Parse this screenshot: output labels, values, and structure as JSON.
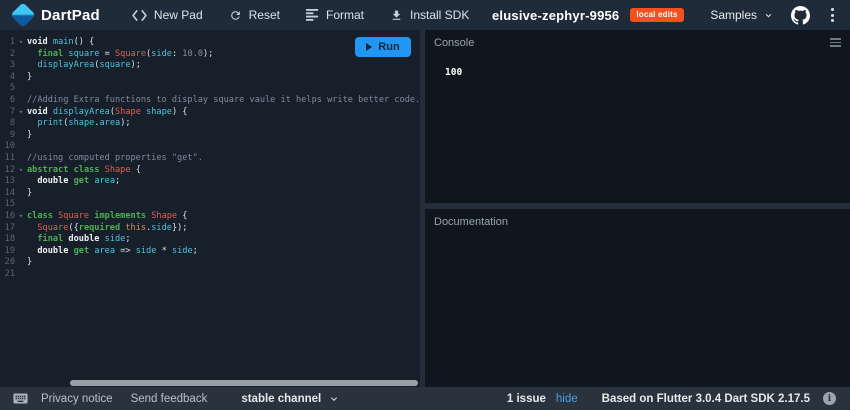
{
  "colors": {
    "accent_blue": "#2196f3",
    "badge_orange": "#f4511e",
    "link_blue": "#4b9fea"
  },
  "header": {
    "logo_text": "DartPad",
    "nav": [
      {
        "label": "New Pad"
      },
      {
        "label": "Reset"
      },
      {
        "label": "Format"
      },
      {
        "label": "Install SDK"
      }
    ],
    "title": "elusive-zephyr-9956",
    "badge": "local edits",
    "samples_label": "Samples"
  },
  "editor": {
    "run_label": "Run",
    "fold_glyph": "▾",
    "lines": [
      {
        "n": "1",
        "fold": true,
        "tokens": [
          [
            "bd",
            "void"
          ],
          [
            "pl",
            " "
          ],
          [
            "id",
            "main"
          ],
          [
            "pl",
            "() {"
          ]
        ]
      },
      {
        "n": "2",
        "fold": false,
        "tokens": [
          [
            "pl",
            "  "
          ],
          [
            "kw",
            "final"
          ],
          [
            "pl",
            " "
          ],
          [
            "id",
            "square"
          ],
          [
            "pl",
            " = "
          ],
          [
            "ty",
            "Square"
          ],
          [
            "pl",
            "("
          ],
          [
            "id",
            "side"
          ],
          [
            "pl",
            ": "
          ],
          [
            "num",
            "10.0"
          ],
          [
            "pl",
            ");"
          ]
        ]
      },
      {
        "n": "3",
        "fold": false,
        "tokens": [
          [
            "pl",
            "  "
          ],
          [
            "id",
            "displayArea"
          ],
          [
            "pl",
            "("
          ],
          [
            "id",
            "square"
          ],
          [
            "pl",
            ");"
          ]
        ]
      },
      {
        "n": "4",
        "fold": false,
        "tokens": [
          [
            "pl",
            "}"
          ]
        ]
      },
      {
        "n": "5",
        "fold": false,
        "tokens": []
      },
      {
        "n": "6",
        "fold": false,
        "tokens": [
          [
            "cm",
            "//Adding Extra functions to display square vaule it helps write better code."
          ]
        ]
      },
      {
        "n": "7",
        "fold": true,
        "tokens": [
          [
            "bd",
            "void"
          ],
          [
            "pl",
            " "
          ],
          [
            "id",
            "displayArea"
          ],
          [
            "pl",
            "("
          ],
          [
            "ty",
            "Shape"
          ],
          [
            "pl",
            " "
          ],
          [
            "id",
            "shape"
          ],
          [
            "pl",
            ") {"
          ]
        ]
      },
      {
        "n": "8",
        "fold": false,
        "tokens": [
          [
            "pl",
            "  "
          ],
          [
            "id",
            "print"
          ],
          [
            "pl",
            "("
          ],
          [
            "id",
            "shape"
          ],
          [
            "pl",
            "."
          ],
          [
            "id",
            "area"
          ],
          [
            "pl",
            ");"
          ]
        ]
      },
      {
        "n": "9",
        "fold": false,
        "tokens": [
          [
            "pl",
            "}"
          ]
        ]
      },
      {
        "n": "10",
        "fold": false,
        "tokens": []
      },
      {
        "n": "11",
        "fold": false,
        "tokens": [
          [
            "cm",
            "//using computed properties \"get\"."
          ]
        ]
      },
      {
        "n": "12",
        "fold": true,
        "tokens": [
          [
            "kw",
            "abstract"
          ],
          [
            "pl",
            " "
          ],
          [
            "kw",
            "class"
          ],
          [
            "pl",
            " "
          ],
          [
            "ty",
            "Shape"
          ],
          [
            "pl",
            " {"
          ]
        ]
      },
      {
        "n": "13",
        "fold": false,
        "tokens": [
          [
            "pl",
            "  "
          ],
          [
            "bd",
            "double"
          ],
          [
            "pl",
            " "
          ],
          [
            "kw",
            "get"
          ],
          [
            "pl",
            " "
          ],
          [
            "id",
            "area"
          ],
          [
            "pl",
            ";"
          ]
        ]
      },
      {
        "n": "14",
        "fold": false,
        "tokens": [
          [
            "pl",
            "}"
          ]
        ]
      },
      {
        "n": "15",
        "fold": false,
        "tokens": []
      },
      {
        "n": "16",
        "fold": true,
        "tokens": [
          [
            "kw",
            "class"
          ],
          [
            "pl",
            " "
          ],
          [
            "ty",
            "Square"
          ],
          [
            "pl",
            " "
          ],
          [
            "kw",
            "implements"
          ],
          [
            "pl",
            " "
          ],
          [
            "ty",
            "Shape"
          ],
          [
            "pl",
            " {"
          ]
        ]
      },
      {
        "n": "17",
        "fold": false,
        "tokens": [
          [
            "pl",
            "  "
          ],
          [
            "ty",
            "Square"
          ],
          [
            "pl",
            "({"
          ],
          [
            "kw",
            "required"
          ],
          [
            "pl",
            " "
          ],
          [
            "th",
            "this"
          ],
          [
            "pl",
            "."
          ],
          [
            "id",
            "side"
          ],
          [
            "pl",
            "});"
          ]
        ]
      },
      {
        "n": "18",
        "fold": false,
        "tokens": [
          [
            "pl",
            "  "
          ],
          [
            "kw",
            "final"
          ],
          [
            "pl",
            " "
          ],
          [
            "bd",
            "double"
          ],
          [
            "pl",
            " "
          ],
          [
            "id",
            "side"
          ],
          [
            "pl",
            ";"
          ]
        ]
      },
      {
        "n": "19",
        "fold": false,
        "tokens": [
          [
            "pl",
            "  "
          ],
          [
            "bd",
            "double"
          ],
          [
            "pl",
            " "
          ],
          [
            "kw",
            "get"
          ],
          [
            "pl",
            " "
          ],
          [
            "id",
            "area"
          ],
          [
            "pl",
            " => "
          ],
          [
            "id",
            "side"
          ],
          [
            "pl",
            " * "
          ],
          [
            "id",
            "side"
          ],
          [
            "pl",
            ";"
          ]
        ]
      },
      {
        "n": "20",
        "fold": false,
        "tokens": [
          [
            "pl",
            "}"
          ]
        ]
      },
      {
        "n": "21",
        "fold": false,
        "tokens": []
      }
    ]
  },
  "console": {
    "title": "Console",
    "output": "100"
  },
  "documentation": {
    "title": "Documentation"
  },
  "footer": {
    "privacy": "Privacy notice",
    "feedback": "Send feedback",
    "channel": "stable channel",
    "issues": "1 issue",
    "hide": "hide",
    "based": "Based on Flutter 3.0.4 Dart SDK 2.17.5",
    "info": "i"
  }
}
